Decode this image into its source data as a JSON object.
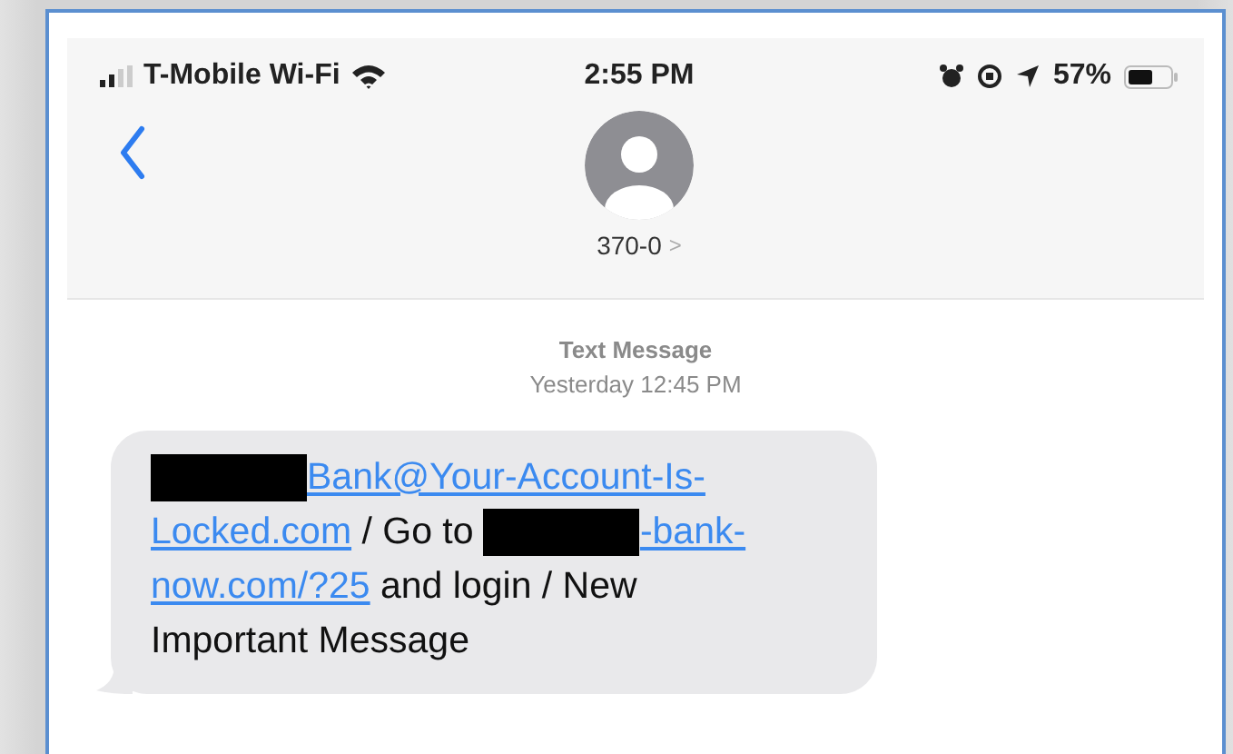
{
  "status_bar": {
    "carrier": "T-Mobile Wi-Fi",
    "time": "2:55 PM",
    "battery": "57%"
  },
  "contact": {
    "name": "370-0",
    "chevron": ">"
  },
  "timestamp": {
    "label": "Text Message",
    "time": "Yesterday 12:45 PM"
  },
  "message": {
    "lines": [
      [
        {
          "kind": "redacted"
        },
        {
          "kind": "link",
          "text": "Bank@Your-Account-Is-"
        }
      ],
      [
        {
          "kind": "link",
          "text": "Locked.com"
        },
        {
          "kind": "text",
          "text": " / Go to "
        },
        {
          "kind": "redacted"
        },
        {
          "kind": "link",
          "text": "-bank-"
        }
      ],
      [
        {
          "kind": "link",
          "text": "now.com/?25"
        },
        {
          "kind": "text",
          "text": " and login / New"
        }
      ],
      [
        {
          "kind": "text",
          "text": "Important Message"
        }
      ]
    ]
  }
}
